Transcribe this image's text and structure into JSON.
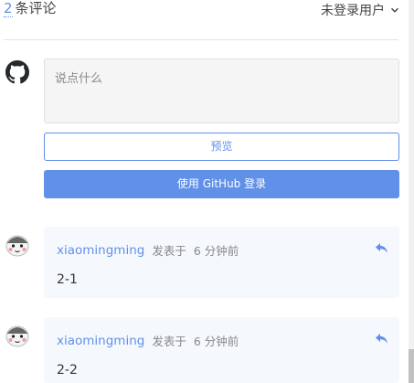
{
  "header": {
    "comment_count": "2",
    "comment_count_suffix": "条评论",
    "user_status": "未登录用户"
  },
  "editor": {
    "placeholder": "说点什么",
    "preview_label": "预览",
    "login_label": "使用 GitHub 登录"
  },
  "comments": [
    {
      "author": "xiaomingming",
      "posted_label": "发表于",
      "time": "6 分钟前",
      "body": "2-1"
    },
    {
      "author": "xiaomingming",
      "posted_label": "发表于",
      "time": "6 分钟前",
      "body": "2-2"
    }
  ],
  "colors": {
    "accent": "#6190e8",
    "comment_bg": "#f5f9fe",
    "textarea_bg": "#f5f5f5"
  },
  "icons": {
    "logo": "github-icon",
    "reply": "reply-icon",
    "dropdown": "chevron-down-icon"
  }
}
